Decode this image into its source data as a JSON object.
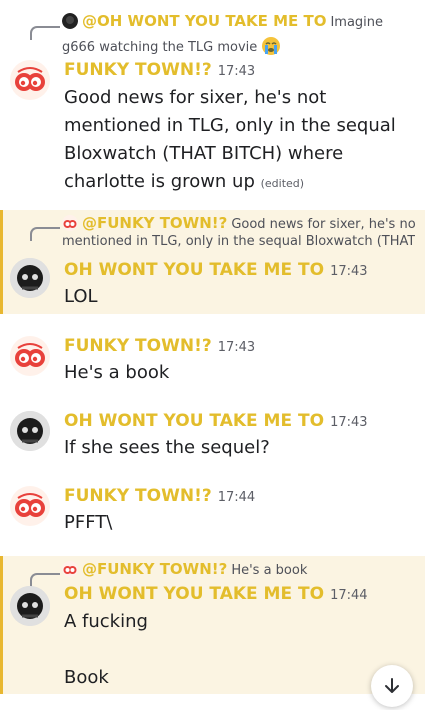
{
  "messages": [
    {
      "reply": {
        "user": "@OH WONT YOU TAKE ME TO",
        "text": "Imagine",
        "text2": "g666 watching the TLG movie"
      },
      "user": "FUNKY TOWN!?",
      "time": "17:43",
      "text": "Good news for sixer, he's not mentioned in TLG, only in the sequal Bloxwatch (THAT BITCH) where charlotte is grown up",
      "edited": "(edited)"
    },
    {
      "reply": {
        "user": "@FUNKY TOWN!?",
        "text": "Good news for sixer, he's not",
        "text2": "mentioned in TLG, only in the sequal Bloxwatch (THAT ..."
      },
      "user": "OH WONT YOU TAKE ME TO",
      "time": "17:43",
      "text": "LOL"
    },
    {
      "user": "FUNKY TOWN!?",
      "time": "17:43",
      "text": "He's a book"
    },
    {
      "user": "OH WONT YOU TAKE ME TO",
      "time": "17:43",
      "text": "If she sees the sequel?"
    },
    {
      "user": "FUNKY TOWN!?",
      "time": "17:44",
      "text": "PFFT\\"
    },
    {
      "reply": {
        "user": "@FUNKY TOWN!?",
        "text": "He's a book"
      },
      "user": "OH WONT YOU TAKE ME TO",
      "time": "17:44",
      "text": "A fucking\n\nBook"
    }
  ],
  "colors": {
    "username": "#e3bd2c",
    "highlight_bg": "#fbf4e2",
    "highlight_bar": "#e8b730"
  }
}
